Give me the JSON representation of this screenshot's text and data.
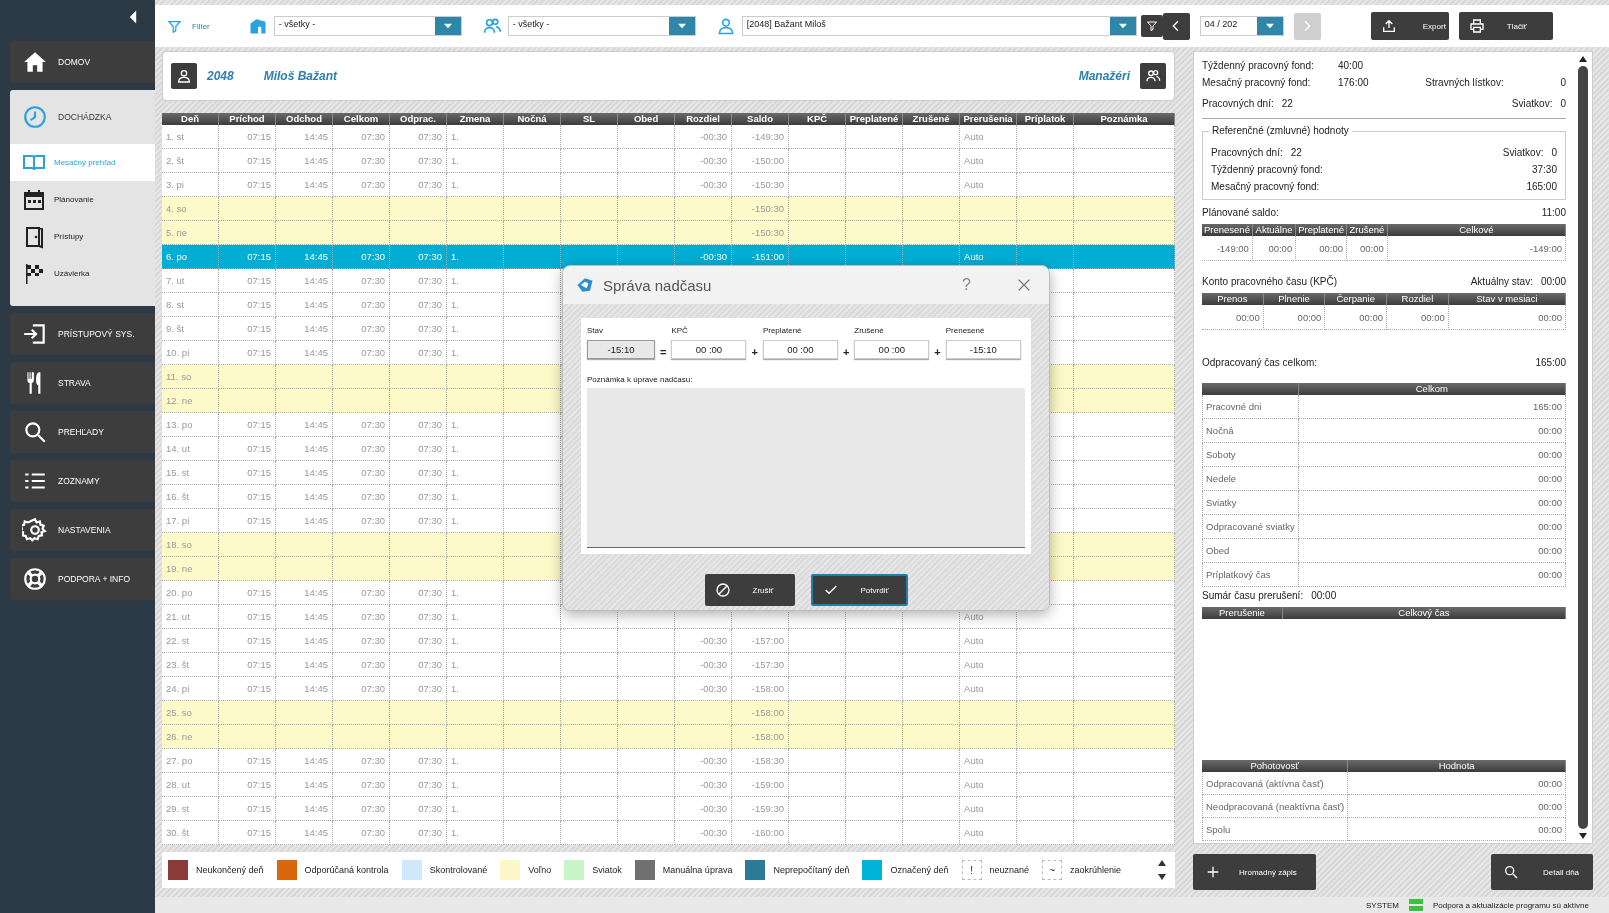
{
  "sidebar": {
    "items": [
      {
        "label": "DOMOV",
        "selected": false
      },
      {
        "label": "DOCHÁDZKA",
        "selected": false,
        "expanded": true,
        "children": [
          {
            "label": "Mesačný prehľad",
            "selected": true
          },
          {
            "label": "Plánovanie",
            "selected": false
          },
          {
            "label": "Prístupy",
            "selected": false
          },
          {
            "label": "Uzávierka",
            "selected": false
          }
        ]
      },
      {
        "label": "PRÍSTUPOVÝ SYS.",
        "selected": false
      },
      {
        "label": "STRAVA",
        "selected": false
      },
      {
        "label": "PREHĽADY",
        "selected": false
      },
      {
        "label": "ZOZNAMY",
        "selected": false
      },
      {
        "label": "NASTAVENIA",
        "selected": false
      },
      {
        "label": "PODPORA + INFO",
        "selected": false
      }
    ]
  },
  "toolbar": {
    "filter_label": "Filter",
    "department": "- všetky -",
    "group": "- všetky -",
    "employee": "[2048] Bažant Miloš",
    "period": "04 / 202",
    "prev": {
      "disabled": false
    },
    "next": {
      "disabled": true
    },
    "export_label": "Export",
    "print_label": "Tlačiť"
  },
  "employee_card": {
    "number": "2048",
    "name": "Miloš Bažant",
    "managers_label": "Manažéri"
  },
  "table": {
    "columns": [
      "Deň",
      "Príchod",
      "Odchod",
      "Celkom",
      "Odprac.",
      "Zmena",
      "Nočná",
      "SL",
      "Obed",
      "Rozdiel",
      "Saldo",
      "KPČ",
      "Preplatené",
      "Zrušené",
      "Prerušenia",
      "Príplatok",
      "Poznámka"
    ],
    "rows": [
      {
        "day": "1. st",
        "arrival": "07:15",
        "departure": "14:45",
        "total": "07:30",
        "worked": "07:30",
        "shift": "1.",
        "difference": "-00:30",
        "balance": "-149:30",
        "interruption": "Auto",
        "kind": "workday",
        "selected": false
      },
      {
        "day": "2. št",
        "arrival": "07:15",
        "departure": "14:45",
        "total": "07:30",
        "worked": "07:30",
        "shift": "1.",
        "difference": "-00:30",
        "balance": "-150:00",
        "interruption": "Auto",
        "kind": "workday",
        "selected": false
      },
      {
        "day": "3. pi",
        "arrival": "07:15",
        "departure": "14:45",
        "total": "07:30",
        "worked": "07:30",
        "shift": "1.",
        "difference": "-00:30",
        "balance": "-150:30",
        "interruption": "Auto",
        "kind": "workday",
        "selected": false
      },
      {
        "day": "4. so",
        "balance": "-150:30",
        "kind": "free",
        "selected": false
      },
      {
        "day": "5. ne",
        "balance": "-150:30",
        "kind": "free",
        "selected": false
      },
      {
        "day": "6. po",
        "arrival": "07:15",
        "departure": "14:45",
        "total": "07:30",
        "worked": "07:30",
        "shift": "1.",
        "difference": "-00:30",
        "balance": "-151:00",
        "interruption": "Auto",
        "kind": "workday",
        "selected": true
      },
      {
        "day": "7. ut",
        "arrival": "07:15",
        "departure": "14:45",
        "total": "07:30",
        "worked": "07:30",
        "shift": "1.",
        "kind": "workday",
        "selected": false
      },
      {
        "day": "8. st",
        "arrival": "07:15",
        "departure": "14:45",
        "total": "07:30",
        "worked": "07:30",
        "shift": "1.",
        "kind": "workday",
        "selected": false
      },
      {
        "day": "9. št",
        "arrival": "07:15",
        "departure": "14:45",
        "total": "07:30",
        "worked": "07:30",
        "shift": "1.",
        "kind": "workday",
        "selected": false
      },
      {
        "day": "10. pi",
        "arrival": "07:15",
        "departure": "14:45",
        "total": "07:30",
        "worked": "07:30",
        "shift": "1.",
        "kind": "workday",
        "selected": false
      },
      {
        "day": "11. so",
        "kind": "free",
        "selected": false
      },
      {
        "day": "12. ne",
        "kind": "free",
        "selected": false
      },
      {
        "day": "13. po",
        "arrival": "07:15",
        "departure": "14:45",
        "total": "07:30",
        "worked": "07:30",
        "shift": "1.",
        "kind": "workday",
        "selected": false
      },
      {
        "day": "14. ut",
        "arrival": "07:15",
        "departure": "14:45",
        "total": "07:30",
        "worked": "07:30",
        "shift": "1.",
        "kind": "workday",
        "selected": false
      },
      {
        "day": "15. st",
        "arrival": "07:15",
        "departure": "14:45",
        "total": "07:30",
        "worked": "07:30",
        "shift": "1.",
        "kind": "workday",
        "selected": false
      },
      {
        "day": "16. št",
        "arrival": "07:15",
        "departure": "14:45",
        "total": "07:30",
        "worked": "07:30",
        "shift": "1.",
        "kind": "workday",
        "selected": false
      },
      {
        "day": "17. pi",
        "arrival": "07:15",
        "departure": "14:45",
        "total": "07:30",
        "worked": "07:30",
        "shift": "1.",
        "kind": "workday",
        "selected": false
      },
      {
        "day": "18. so",
        "kind": "free",
        "selected": false
      },
      {
        "day": "19. ne",
        "kind": "free",
        "selected": false
      },
      {
        "day": "20. po",
        "arrival": "07:15",
        "departure": "14:45",
        "total": "07:30",
        "worked": "07:30",
        "shift": "1.",
        "kind": "workday",
        "selected": false
      },
      {
        "day": "21. ut",
        "arrival": "07:15",
        "departure": "14:45",
        "total": "07:30",
        "worked": "07:30",
        "shift": "1.",
        "interruption": "Auto",
        "kind": "workday",
        "selected": false
      },
      {
        "day": "22. st",
        "arrival": "07:15",
        "departure": "14:45",
        "total": "07:30",
        "worked": "07:30",
        "shift": "1.",
        "difference": "-00:30",
        "balance": "-157:00",
        "interruption": "Auto",
        "kind": "workday",
        "selected": false
      },
      {
        "day": "23. št",
        "arrival": "07:15",
        "departure": "14:45",
        "total": "07:30",
        "worked": "07:30",
        "shift": "1.",
        "difference": "-00:30",
        "balance": "-157:30",
        "interruption": "Auto",
        "kind": "workday",
        "selected": false
      },
      {
        "day": "24. pi",
        "arrival": "07:15",
        "departure": "14:45",
        "total": "07:30",
        "worked": "07:30",
        "shift": "1.",
        "difference": "-00:30",
        "balance": "-158:00",
        "interruption": "Auto",
        "kind": "workday",
        "selected": false
      },
      {
        "day": "25. so",
        "balance": "-158:00",
        "kind": "free",
        "selected": false
      },
      {
        "day": "26. ne",
        "balance": "-158:00",
        "kind": "free",
        "selected": false
      },
      {
        "day": "27. po",
        "arrival": "07:15",
        "departure": "14:45",
        "total": "07:30",
        "worked": "07:30",
        "shift": "1.",
        "difference": "-00:30",
        "balance": "-158:30",
        "interruption": "Auto",
        "kind": "workday",
        "selected": false
      },
      {
        "day": "28. ut",
        "arrival": "07:15",
        "departure": "14:45",
        "total": "07:30",
        "worked": "07:30",
        "shift": "1.",
        "difference": "-00:30",
        "balance": "-159:00",
        "interruption": "Auto",
        "kind": "workday",
        "selected": false
      },
      {
        "day": "29. st",
        "arrival": "07:15",
        "departure": "14:45",
        "total": "07:30",
        "worked": "07:30",
        "shift": "1.",
        "difference": "-00:30",
        "balance": "-159:30",
        "interruption": "Auto",
        "kind": "workday",
        "selected": false
      },
      {
        "day": "30. št",
        "arrival": "07:15",
        "departure": "14:45",
        "total": "07:30",
        "worked": "07:30",
        "shift": "1.",
        "difference": "-00:30",
        "balance": "-160:00",
        "interruption": "Auto",
        "kind": "workday",
        "selected": false
      }
    ]
  },
  "legend": [
    {
      "kind": "swatch",
      "label": "Neukončený deň",
      "color": "#8b3a3a"
    },
    {
      "kind": "swatch",
      "label": "Odporúčaná kontrola",
      "color": "#d9670e"
    },
    {
      "kind": "swatch",
      "label": "Skontrolované",
      "color": "#cfe8fb"
    },
    {
      "kind": "swatch",
      "label": "Voľno",
      "color": "#fdf8c8"
    },
    {
      "kind": "swatch",
      "label": "Sviatok",
      "color": "#c8f5c8"
    },
    {
      "kind": "swatch",
      "label": "Manuálna úprava",
      "color": "#707070"
    },
    {
      "kind": "swatch",
      "label": "Neprepočítaný deň",
      "color": "#2c7a96"
    },
    {
      "kind": "swatch",
      "label": "Označený deň",
      "color": "#00b4d8"
    },
    {
      "kind": "symbol",
      "symbol": "!",
      "label": "neuznané"
    },
    {
      "kind": "symbol",
      "symbol": "~",
      "label": "zaokrúhlenie"
    }
  ],
  "summary": {
    "weekly_fund": {
      "label": "Týždenný pracovný fond:",
      "value": "40:00"
    },
    "monthly_fund": {
      "label": "Mesačný pracovný fond:",
      "value": "176:00"
    },
    "meal_tickets": {
      "label": "Stravných lístkov:",
      "value": "0"
    },
    "working_days": {
      "label": "Pracovných dní:",
      "value": "22"
    },
    "holidays": {
      "label": "Sviatkov:",
      "value": "0"
    }
  },
  "reference": {
    "title": "Referenčné (zmluvné) hodnoty",
    "working_days": {
      "label": "Pracovných dní:",
      "value": "22"
    },
    "holidays": {
      "label": "Sviatkov:",
      "value": "0"
    },
    "weekly_fund": {
      "label": "Týždenný pracovný fond:",
      "value": "37:30"
    },
    "monthly_fund": {
      "label": "Mesačný pracovný fond:",
      "value": "165:00"
    }
  },
  "planned_balance": {
    "label": "Plánované saldo:",
    "value": "11:00",
    "columns": [
      "Prenesené",
      "Aktuálne",
      "Preplatené",
      "Zrušené",
      "Celkové"
    ],
    "values": [
      "-149:00",
      "00:00",
      "00:00",
      "00:00",
      "-149:00"
    ]
  },
  "kpc": {
    "title": "Konto pracovného času (KPČ)",
    "state_label": "Aktuálny stav:",
    "state_value": "00:00",
    "columns": [
      "Prenos",
      "Plnenie",
      "Čerpanie",
      "Rozdiel",
      "Stav v mesiaci"
    ],
    "values": [
      "00:00",
      "00:00",
      "00:00",
      "00:00",
      "00:00"
    ]
  },
  "worked": {
    "label": "Odpracovaný čas celkom:",
    "value": "165:00",
    "column": "Celkom",
    "rows": [
      {
        "label": "Pracovné dni",
        "value": "165:00"
      },
      {
        "label": "Nočná",
        "value": "00:00"
      },
      {
        "label": "Soboty",
        "value": "00:00"
      },
      {
        "label": "Nedele",
        "value": "00:00"
      },
      {
        "label": "Sviatky",
        "value": "00:00"
      },
      {
        "label": "Odpracované sviatky",
        "value": "00:00"
      },
      {
        "label": "Obed",
        "value": "00:00"
      },
      {
        "label": "Príplatkový čas",
        "value": "00:00"
      }
    ]
  },
  "interruptions": {
    "label": "Sumár času prerušení:",
    "value": "00:00",
    "columns": [
      "Prerušenie",
      "Celkový čas"
    ]
  },
  "standby": {
    "columns": [
      "Pohotovosť",
      "Hodnota"
    ],
    "rows": [
      {
        "label": "Odpracovaná (aktívna časť)",
        "value": "00:00"
      },
      {
        "label": "Neodpracovaná (neaktívna časť)",
        "value": "00:00"
      },
      {
        "label": "Spolu",
        "value": "00:00"
      }
    ]
  },
  "actions": {
    "bulk": "Hromadný zápis",
    "detail": "Detail dňa"
  },
  "status_bar": {
    "user": "SYSTEM",
    "message": "Podpora a aktualizácie programu sú aktívne"
  },
  "dialog": {
    "title": "Správa nadčasu",
    "help": "?",
    "fields": [
      {
        "label": "Stav",
        "value": "-15:10",
        "readonly": true
      },
      {
        "label": "KPČ",
        "value": "00 :00",
        "readonly": false,
        "operator": "="
      },
      {
        "label": "Preplatené",
        "value": "00 :00",
        "readonly": false,
        "operator": "+"
      },
      {
        "label": "Zrušené",
        "value": "00 :00",
        "readonly": false,
        "operator": "+"
      },
      {
        "label": "Prenesené",
        "value": "-15:10",
        "readonly": false,
        "operator": "+"
      }
    ],
    "note_label": "Poznámka k úprave nadčasu:",
    "cancel": "Zrušiť",
    "confirm": "Potvrdiť"
  }
}
